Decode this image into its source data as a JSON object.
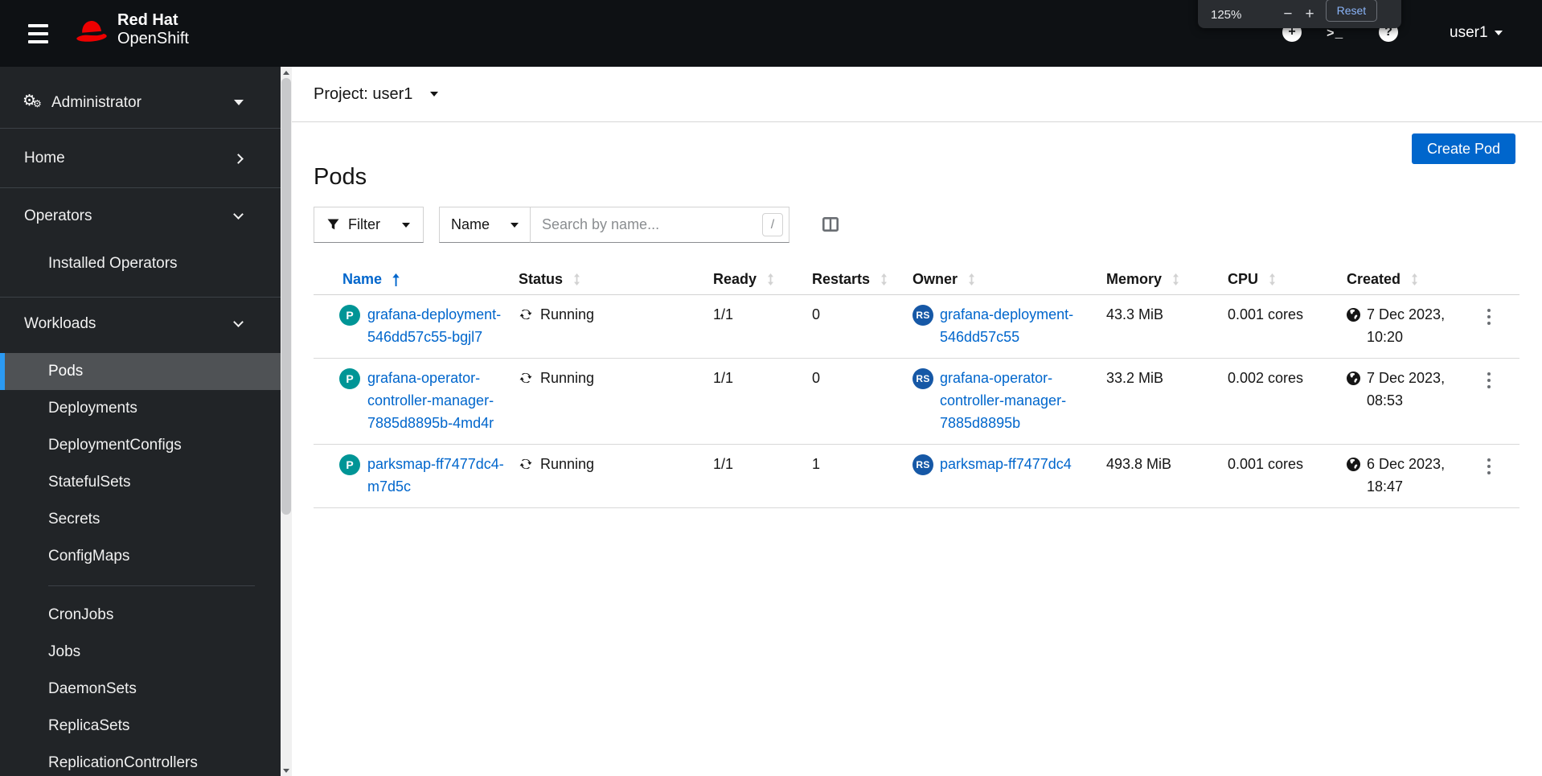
{
  "colors": {
    "accent": "#0066cc",
    "link": "#0066cc",
    "masthead_bg": "#0e1114",
    "sidebar_bg": "#212427",
    "sidebar_selected_bg": "#4f5255",
    "sidebar_selected_border": "#2b9af3",
    "pod_badge": "#009596",
    "replicaset_badge": "#1658a6",
    "reset_link": "#8ab4f8"
  },
  "masthead": {
    "logo_line1": "Red Hat",
    "logo_line2": "OpenShift",
    "user": "user1",
    "plus_glyph": "+",
    "terminal_glyph": ">_",
    "help_glyph": "?"
  },
  "zoom_popup": {
    "level": "125%",
    "minus": "−",
    "plus": "+",
    "reset": "Reset"
  },
  "sidebar": {
    "perspective": "Administrator",
    "home": "Home",
    "operators": "Operators",
    "installed_operators": "Installed Operators",
    "workloads": "Workloads",
    "workloads_items": [
      "Pods",
      "Deployments",
      "DeploymentConfigs",
      "StatefulSets",
      "Secrets",
      "ConfigMaps",
      "CronJobs",
      "Jobs",
      "DaemonSets",
      "ReplicaSets",
      "ReplicationControllers"
    ],
    "selected_item": "Pods"
  },
  "project_bar": {
    "label": "Project: user1"
  },
  "page": {
    "title": "Pods",
    "create_button": "Create Pod"
  },
  "toolbar": {
    "filter_label": "Filter",
    "attribute_label": "Name",
    "search_placeholder": "Search by name...",
    "shortcut_hint": "/"
  },
  "table": {
    "columns": [
      "Name",
      "Status",
      "Ready",
      "Restarts",
      "Owner",
      "Memory",
      "CPU",
      "Created"
    ],
    "sort": {
      "column": "Name",
      "direction": "ascending"
    },
    "rows": [
      {
        "badge": "P",
        "name_lines": [
          "grafana-deployment-",
          "546dd57c55-bgjl7"
        ],
        "status": "Running",
        "ready": "1/1",
        "restarts": "0",
        "owner_badge": "RS",
        "owner_lines": [
          "grafana-deployment-",
          "546dd57c55"
        ],
        "memory": "43.3 MiB",
        "cpu": "0.001 cores",
        "created_lines": [
          "7 Dec 2023,",
          "10:20"
        ]
      },
      {
        "badge": "P",
        "name_lines": [
          "grafana-operator-",
          "controller-manager-",
          "7885d8895b-4md4r"
        ],
        "status": "Running",
        "ready": "1/1",
        "restarts": "0",
        "owner_badge": "RS",
        "owner_lines": [
          "grafana-operator-",
          "controller-manager-",
          "7885d8895b"
        ],
        "memory": "33.2 MiB",
        "cpu": "0.002 cores",
        "created_lines": [
          "7 Dec 2023,",
          "08:53"
        ]
      },
      {
        "badge": "P",
        "name_lines": [
          "parksmap-ff7477dc4-",
          "m7d5c"
        ],
        "status": "Running",
        "ready": "1/1",
        "restarts": "1",
        "owner_badge": "RS",
        "owner_lines": [
          "parksmap-ff7477dc4"
        ],
        "memory": "493.8 MiB",
        "cpu": "0.001 cores",
        "created_lines": [
          "6 Dec 2023,",
          "18:47"
        ]
      }
    ]
  }
}
